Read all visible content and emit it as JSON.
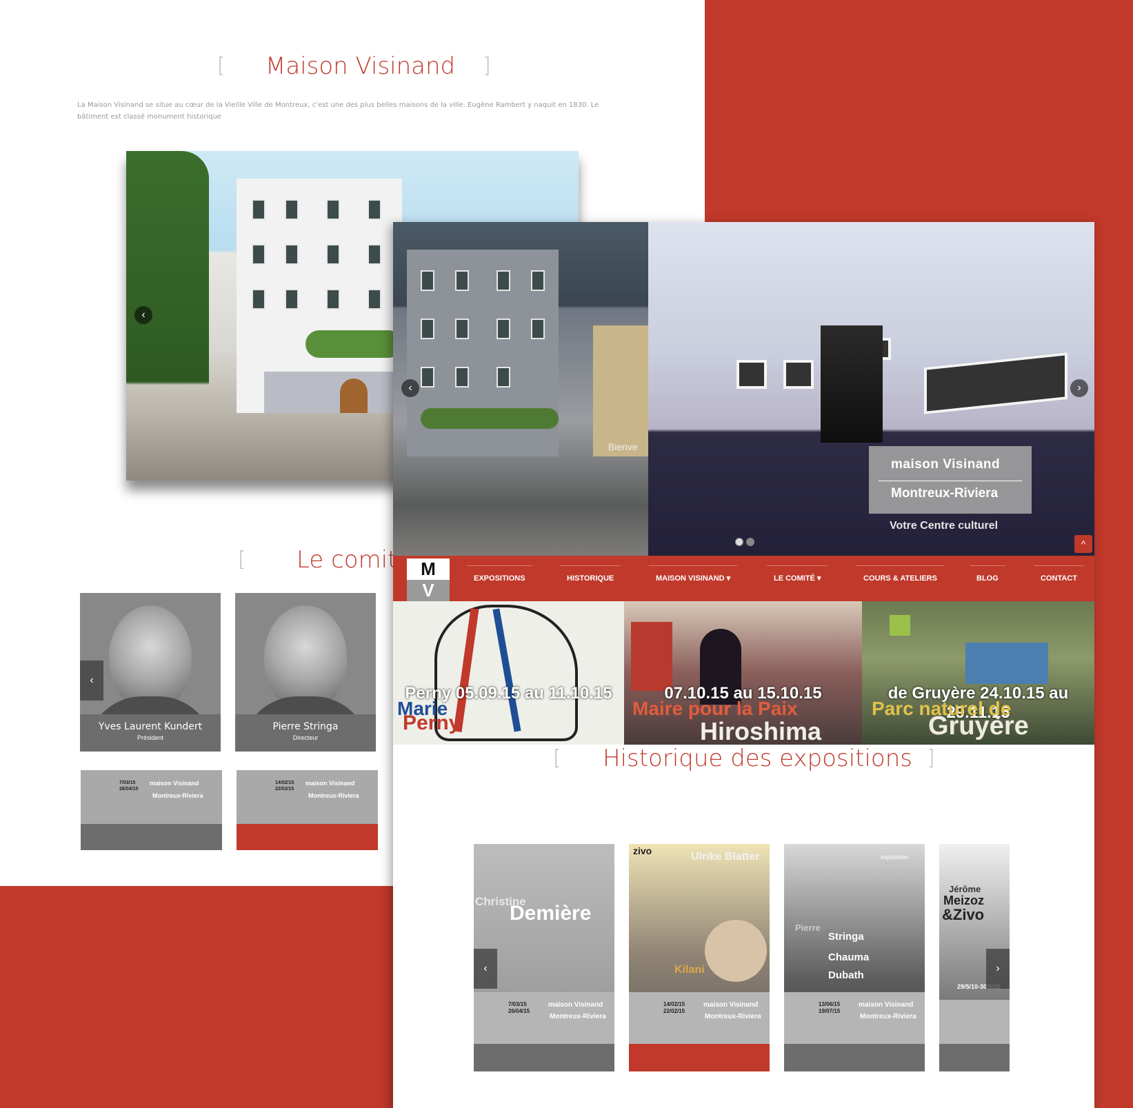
{
  "back": {
    "title": "Maison Visinand",
    "intro": "La Maison Visinand se situe au cœur de la Vieille Ville de Montreux, c'est une des plus belles maisons de la ville. Eugène Rambert y naquit en 1830. Le bâtiment est classé monument historique",
    "bracket_open": "[",
    "bracket_close": "]",
    "committee_title": "Le comité",
    "members": [
      {
        "name": "Yves Laurent Kundert",
        "role": "Président"
      },
      {
        "name": "Pierre Stringa",
        "role": "Directeur"
      }
    ],
    "posters": [
      {
        "dates": "7/03/15\n26/04/15",
        "brand1": "maison Visinand",
        "brand2": "Montreux-Riviera",
        "color": "#6d6d6d"
      },
      {
        "dates": "14/02/15\n22/02/15",
        "brand1": "maison Visinand",
        "brand2": "Montreux-Riviera",
        "color": "#c0392b"
      }
    ],
    "prev_glyph": "‹"
  },
  "front": {
    "brand_line1": "maison Visinand",
    "brand_line2": "Montreux-Riviera",
    "brand_tagline": "Votre Centre culturel",
    "sign_text": "Bienve",
    "prev_glyph": "‹",
    "next_glyph": "›",
    "top_glyph": "^",
    "logo_m": "M",
    "logo_v": "V",
    "nav": [
      {
        "label": "EXPOSITIONS"
      },
      {
        "label": "HISTORIQUE"
      },
      {
        "label": "MAISON VISINAND ▾"
      },
      {
        "label": "LE COMITÉ ▾"
      },
      {
        "label": "COURS & ATELIERS"
      },
      {
        "label": "BLOG"
      },
      {
        "label": "CONTACT"
      }
    ],
    "banners": [
      {
        "caption": "Perny 05.09.15 au 11.10.15",
        "line1": "Marie",
        "line2": "Perny"
      },
      {
        "caption": "07.10.15 au 15.10.15",
        "line1": "Maire pour la Paix",
        "line2": "Hiroshima"
      },
      {
        "caption": "de Gruyère 24.10.15 au 29.11.15",
        "line1": "Parc naturel de",
        "line2": "Gruyère"
      }
    ],
    "history_title": "Historique des expositions",
    "history_posters": [
      {
        "artist1": "Christine",
        "artist2": "Demière",
        "dates": "7/03/15\n26/04/15",
        "brand1": "maison Visinand",
        "brand2": "Montreux-Riviera",
        "color": "#6d6d6d"
      },
      {
        "artist1": "zivo",
        "artist2": "Ulrike Blatter",
        "artist3": "Kilani",
        "dates": "14/02/15\n22/02/15",
        "brand1": "maison Visinand",
        "brand2": "Montreux-Riviera",
        "color": "#c0392b"
      },
      {
        "artist1": "Pierre",
        "artist2": "Stringa",
        "artist3": "Chauma",
        "artist4": "Dubath",
        "label": "exposition",
        "dates": "13/06/15\n19/07/15",
        "brand1": "maison Visinand",
        "brand2": "Montreux-Riviera",
        "color": "#6d6d6d"
      },
      {
        "artist1": "Jérôme",
        "artist2": "Meizoz",
        "artist3": "&Zivo",
        "dates": "29/5/10-30/5/10",
        "color": "#6d6d6d"
      }
    ]
  },
  "colors": {
    "accent": "#c0392b",
    "grey": "#6d6d6d"
  }
}
